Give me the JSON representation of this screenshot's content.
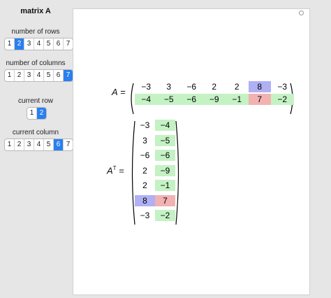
{
  "sidebar": {
    "title": "matrix A",
    "rows_label": "number of rows",
    "rows_options": [
      "1",
      "2",
      "3",
      "4",
      "5",
      "6",
      "7"
    ],
    "rows_selected": "2",
    "cols_label": "number of columns",
    "cols_options": [
      "1",
      "2",
      "3",
      "4",
      "5",
      "6",
      "7"
    ],
    "cols_selected": "7",
    "current_row_label": "current row",
    "current_row_options": [
      "1",
      "2"
    ],
    "current_row_selected": "2",
    "current_col_label": "current column",
    "current_col_options": [
      "1",
      "2",
      "3",
      "4",
      "5",
      "6",
      "7"
    ],
    "current_col_selected": "6"
  },
  "display": {
    "matrix_label": "A",
    "transpose_label_letter": "A",
    "transpose_label_sup": "T",
    "equals": "=",
    "highlight_colors": {
      "row": "#c4f2c4",
      "column": "#b0b0f4",
      "intersection": "#f2b2b2"
    },
    "matrix": [
      [
        "−3",
        "3",
        "−6",
        "2",
        "2",
        "8",
        "−3"
      ],
      [
        "−4",
        "−5",
        "−6",
        "−9",
        "−1",
        "7",
        "−2"
      ]
    ]
  }
}
